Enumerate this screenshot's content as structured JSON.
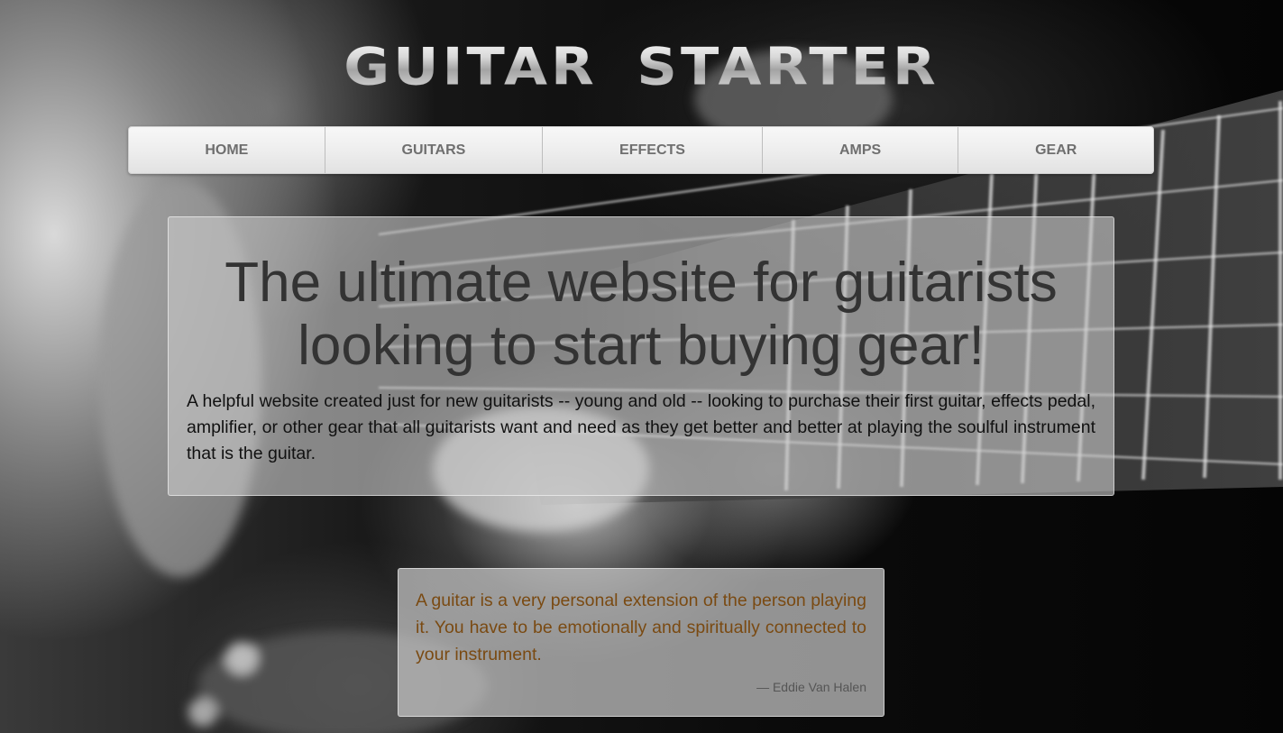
{
  "site": {
    "logo_text": "GUITAR STARTER"
  },
  "nav": {
    "items": [
      {
        "label": "HOME"
      },
      {
        "label": "GUITARS"
      },
      {
        "label": "EFFECTS"
      },
      {
        "label": "AMPS"
      },
      {
        "label": "GEAR"
      }
    ]
  },
  "hero": {
    "title": "The ultimate website for guitarists looking to start buying gear!",
    "description": "A helpful website created just for new guitarists -- young and old -- looking to purchase their first guitar, effects pedal, amplifier, or other gear that all guitarists want and need as they get better and better at playing the soulful instrument that is the guitar."
  },
  "quote": {
    "text": "A guitar is a very personal extension of the person playing it. You have to be emotionally and spiritually connected to your instrument.",
    "author": "— Eddie Van Halen"
  },
  "colors": {
    "quote_text": "#7a4a12",
    "nav_text": "#6f6f6f",
    "title_text": "#333333"
  }
}
